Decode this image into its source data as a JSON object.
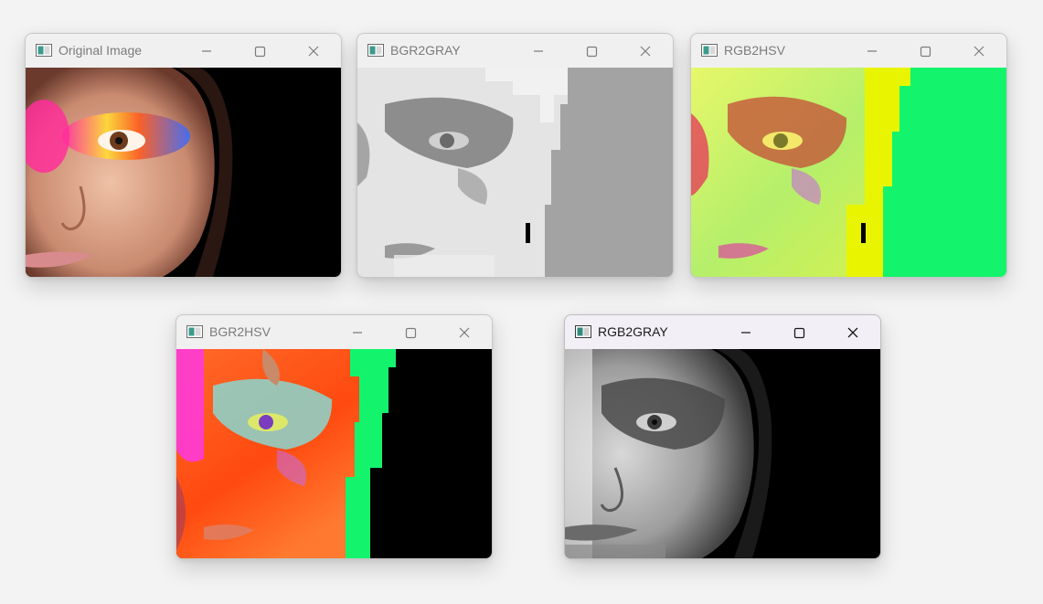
{
  "windows": [
    {
      "id": "original-image",
      "title": "Original Image",
      "active": false
    },
    {
      "id": "bgr2gray",
      "title": "BGR2GRAY",
      "active": false
    },
    {
      "id": "rgb2hsv",
      "title": "RGB2HSV",
      "active": false
    },
    {
      "id": "bgr2hsv",
      "title": "BGR2HSV",
      "active": false
    },
    {
      "id": "rgb2gray",
      "title": "RGB2GRAY",
      "active": true
    }
  ],
  "icons": {
    "app": "window-app-icon",
    "minimize": "minimize-icon",
    "maximize": "maximize-icon",
    "close": "close-icon"
  },
  "colors": {
    "desktop": "#f3f3f3",
    "hsv_green": "#13f46c",
    "gray_background": "#a3a3a3"
  }
}
